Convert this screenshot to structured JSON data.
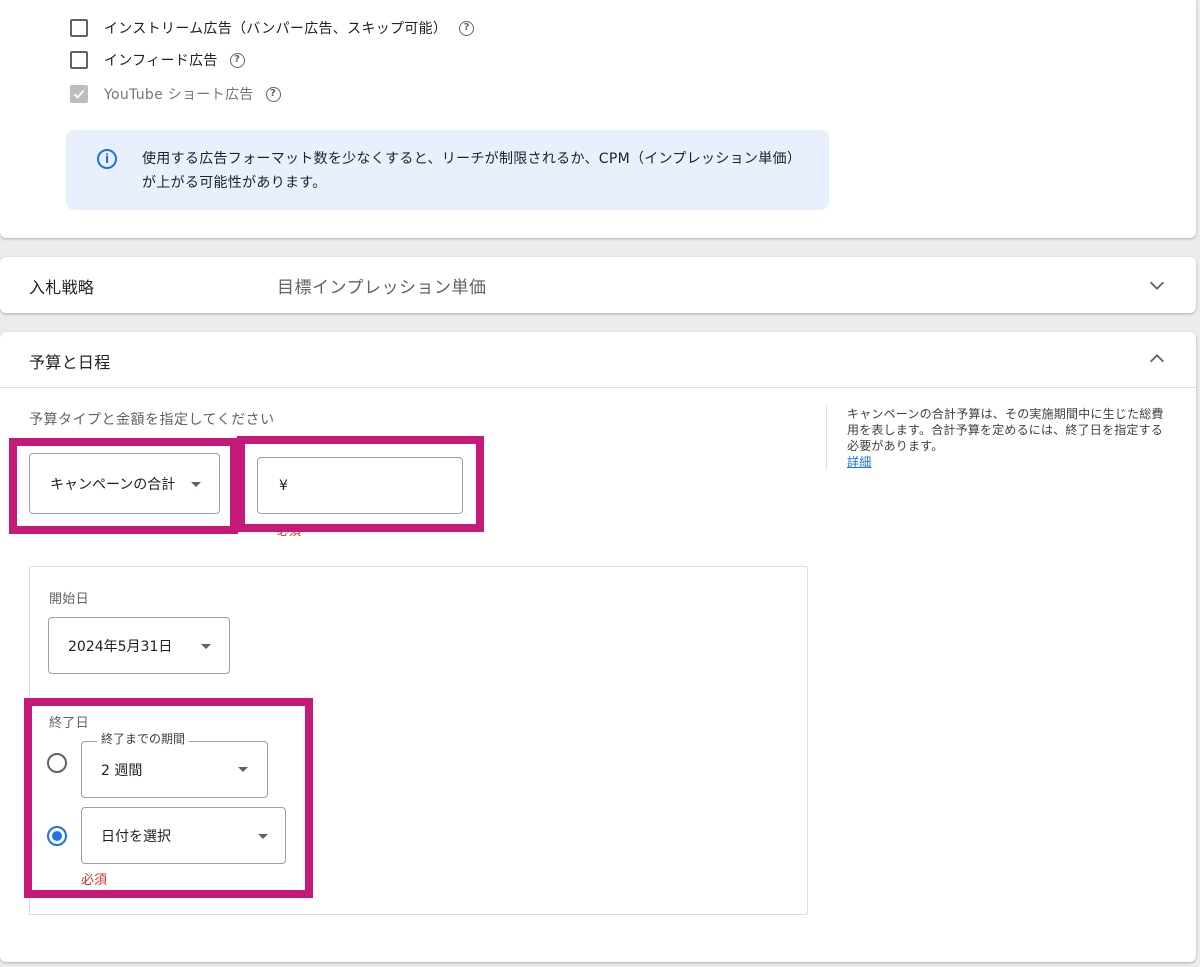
{
  "formats": {
    "instream_label": "インストリーム広告（バンパー広告、スキップ可能）",
    "infeed_label": "インフィード広告",
    "shorts_label": "YouTube ショート広告",
    "help_glyph": "?",
    "info_glyph": "i",
    "info_text": "使用する広告フォーマット数を少なくすると、リーチが制限されるか、CPM（インプレッション単価）が上がる可能性があります。"
  },
  "bidding": {
    "title": "入札戦略",
    "value": "目標インプレッション単価"
  },
  "budget": {
    "title": "予算と日程",
    "prompt": "予算タイプと金額を指定してください",
    "type_value": "キャンペーンの合計",
    "amount_prefix": "¥",
    "amount_value": "",
    "amount_required": "必須",
    "side_help": "キャンペーンの合計予算は、その実施期間中に生じた総費用を表します。合計予算を定めるには、終了日を指定する必要があります。",
    "side_help_link": "詳細"
  },
  "schedule": {
    "start_label": "開始日",
    "start_value": "2024年5月31日",
    "end_label": "終了日",
    "duration_label": "終了までの期間",
    "duration_value": "2 週間",
    "date_value": "日付を選択",
    "end_required": "必須"
  },
  "colors": {
    "highlight": "#c51a7a",
    "accent": "#1a73e8",
    "info_bg": "#e8f0fe",
    "error": "#d93025"
  }
}
